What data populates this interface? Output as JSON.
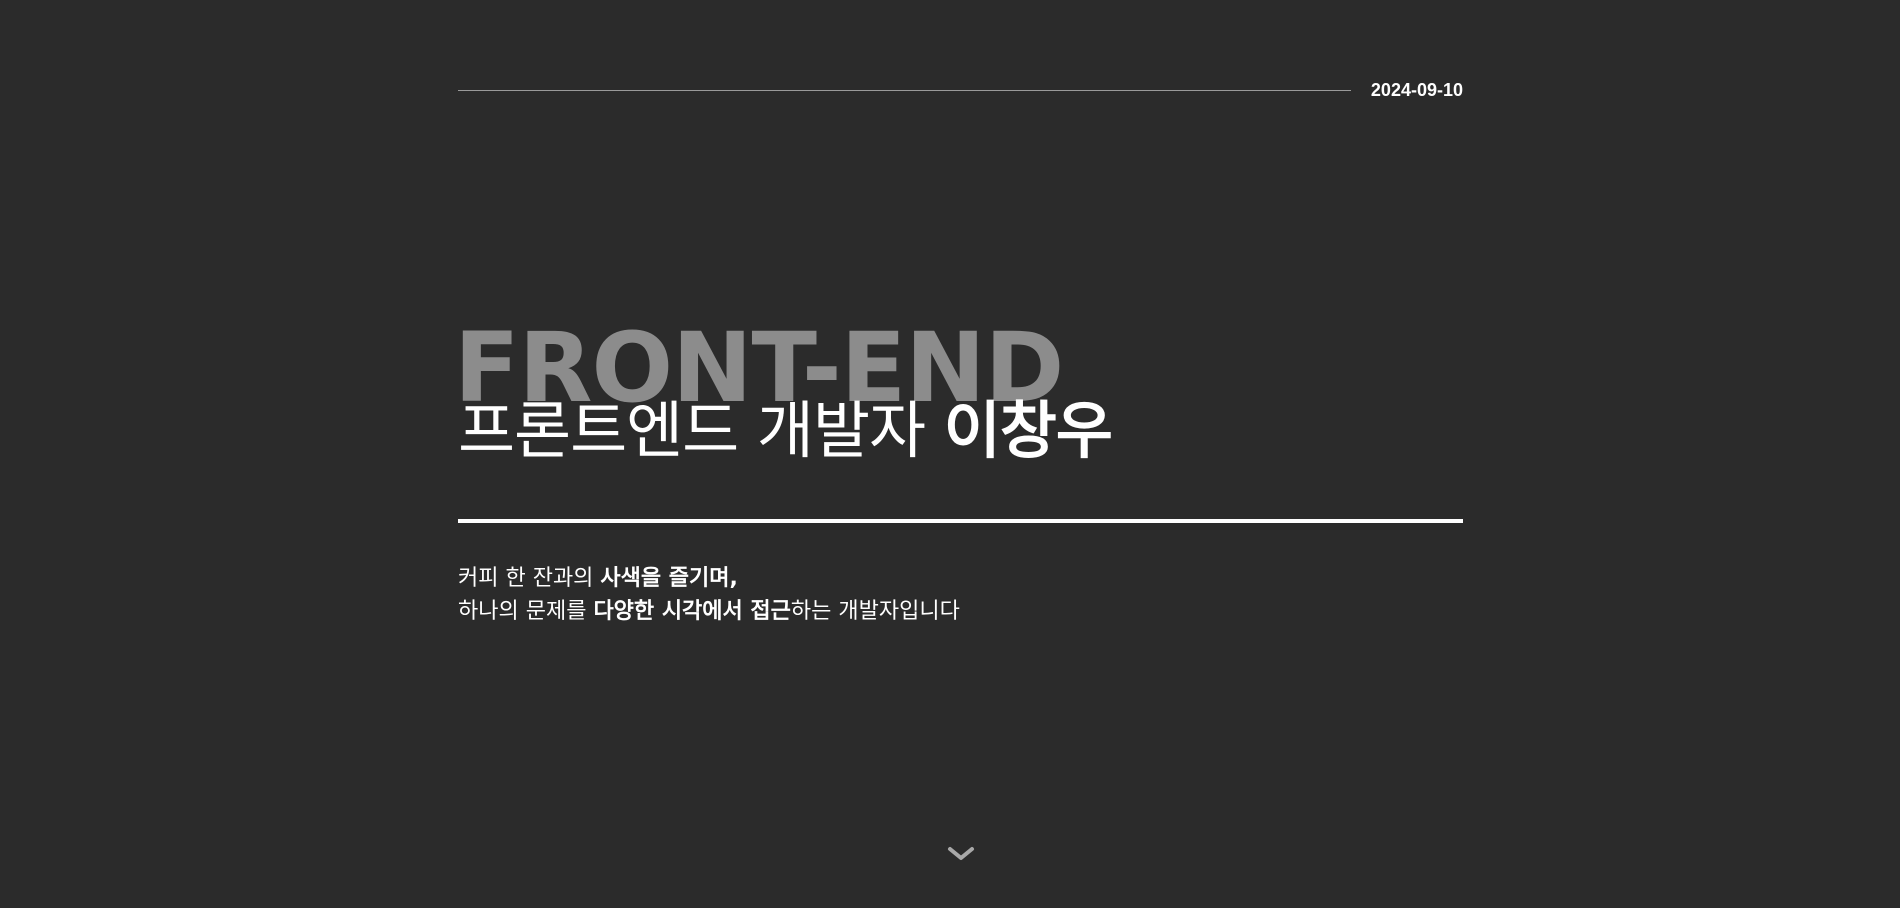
{
  "header": {
    "date": "2024-09-10"
  },
  "hero": {
    "bg_title": "FRONT-END",
    "title_prefix": "프론트엔드 개발자 ",
    "title_name": "이창우"
  },
  "intro": {
    "line1_a": "커피 한 잔과의 ",
    "line1_b": "사색을 즐기며,",
    "line2_a": "하나의 문제를 ",
    "line2_b": "다양한 시각에서 접근",
    "line2_c": "하는 개발자입니다"
  },
  "icons": {
    "scroll": "chevron-down-icon"
  },
  "colors": {
    "background": "#2b2b2b",
    "text": "#ffffff",
    "bg_title": "#8c8c8c",
    "thin_line": "#9a9a9a",
    "chevron": "#a8a8a8"
  }
}
